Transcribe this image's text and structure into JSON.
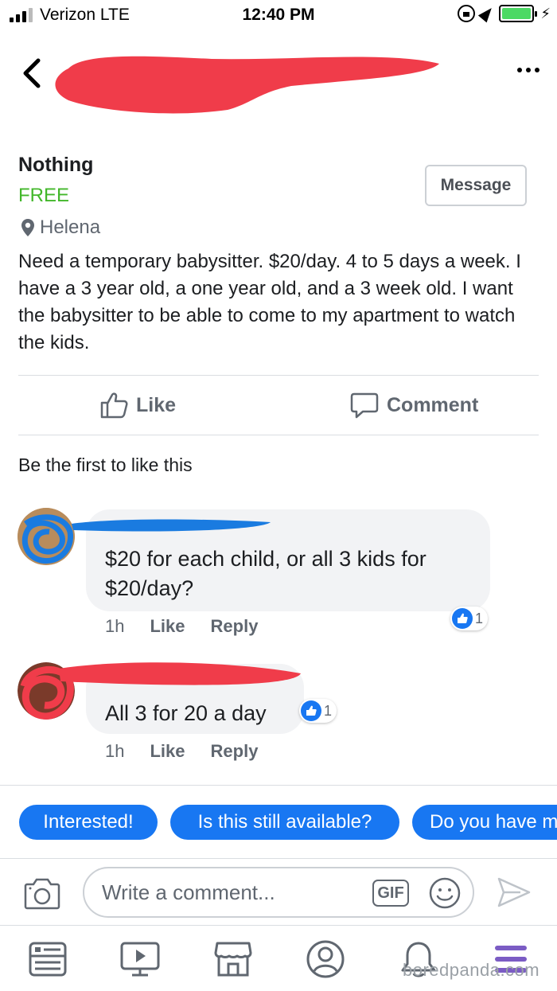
{
  "status_bar": {
    "carrier": "Verizon  LTE",
    "time": "12:40 PM",
    "battery_color": "#4cd964"
  },
  "header": {
    "back_icon": "chevron-left-icon",
    "more_icon": "more-horizontal-icon"
  },
  "listing": {
    "title": "Nothing",
    "price": "FREE",
    "location": "Helena",
    "message_label": "Message",
    "description": "Need a temporary babysitter. $20/day. 4 to 5 days a week. I have a 3 year old, a one year old, and a 3 week old. I want the babysitter to be able to come to my apartment to watch the kids."
  },
  "actions": {
    "like_label": "Like",
    "comment_label": "Comment"
  },
  "likes_summary": "Be the first to like this",
  "comments": [
    {
      "text": "$20 for each child, or all 3 kids for $20/day?",
      "time": "1h",
      "like_label": "Like",
      "reply_label": "Reply",
      "reaction_count": "1"
    },
    {
      "text": "All 3 for 20 a day",
      "time": "1h",
      "like_label": "Like",
      "reply_label": "Reply",
      "reaction_count": "1"
    }
  ],
  "quick_replies": [
    "Interested!",
    "Is this still available?",
    "Do you have more?"
  ],
  "composer": {
    "placeholder": "Write a comment...",
    "gif_label": "GIF"
  },
  "watermark": "boredpanda.com",
  "colors": {
    "accent": "#1877f2",
    "price": "#42b72a",
    "redaction": "#f03c4a",
    "redaction_blue": "#1a7be0"
  }
}
